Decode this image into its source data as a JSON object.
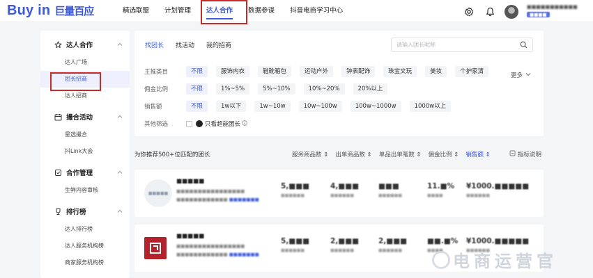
{
  "brand": {
    "en": "Buy in",
    "cn": "巨量百应"
  },
  "topnav": [
    {
      "label": "精选联盟",
      "active": false
    },
    {
      "label": "计划管理",
      "active": false
    },
    {
      "label": "达人合作",
      "active": true
    },
    {
      "label": "数据参谋",
      "active": false
    },
    {
      "label": "抖音电商学习中心",
      "active": false
    }
  ],
  "user": {
    "name": "■■■■■■■■■■■",
    "sub": "■■■■"
  },
  "sidebar": {
    "groups": [
      {
        "label": "达人合作",
        "icon": "star-icon",
        "items": [
          "达人广场",
          "团长招商",
          "达人招商"
        ]
      },
      {
        "label": "撮合活动",
        "icon": "calendar-icon",
        "items": [
          "星选撮合",
          "抖Link大会"
        ]
      },
      {
        "label": "合作管理",
        "icon": "handshake-icon",
        "items": [
          "生鲜内容审核"
        ]
      },
      {
        "label": "排行榜",
        "icon": "trophy-icon",
        "items": [
          "达人排行榜",
          "达人服务机构榜",
          "商家服务机构榜"
        ]
      }
    ],
    "active_item": "团长招商"
  },
  "tabs": [
    {
      "label": "找团长",
      "active": true
    },
    {
      "label": "找活动",
      "active": false
    },
    {
      "label": "我的招商",
      "active": false
    }
  ],
  "search": {
    "placeholder": "请输入团长昵称"
  },
  "filters": {
    "category": {
      "label": "主推类目",
      "options": [
        "不限",
        "服饰内衣",
        "鞋靴箱包",
        "运动户外",
        "钟表配饰",
        "珠宝文玩",
        "美妆",
        "个护家清"
      ],
      "more": "更多"
    },
    "commission": {
      "label": "佣金比例",
      "options": [
        "不限",
        "1%~5%",
        "5%~10%",
        "10%~20%",
        "20%以上"
      ]
    },
    "sales": {
      "label": "销售额",
      "options": [
        "不限",
        "1w以下",
        "1w~10w",
        "10w~100w",
        "100w~1000w",
        "1000w以上"
      ]
    },
    "other": {
      "label": "其他筛选",
      "checkbox_label": "只看超能团长"
    }
  },
  "list": {
    "title": "为你推荐500+位匹配的团长",
    "sorts": [
      {
        "label": "服务商品数",
        "active": false
      },
      {
        "label": "出单商品数",
        "active": false
      },
      {
        "label": "单品出单笔数",
        "active": false
      },
      {
        "label": "佣金比例",
        "active": false
      },
      {
        "label": "销售额",
        "active": true
      }
    ],
    "help": "指标说明"
  },
  "cards": [
    {
      "name": "■■■■■",
      "logo_text": "■■■■■",
      "desc": "■■■■■■■■■■■■■■■■",
      "links": "■■■■■■■■■■■■",
      "link_text": "■■■■■■■",
      "stats": [
        {
          "value": "5,■■■",
          "label": "■■■■■■"
        },
        {
          "value": "4,■■■",
          "label": "■■■■■■"
        },
        {
          "value": "■■■",
          "label": "■■■■■■"
        },
        {
          "value": "11.■%",
          "label": "■■■■"
        },
        {
          "value": "¥1000.■■■■■",
          "label": "■■■■■■"
        }
      ]
    },
    {
      "name": "■■■■■",
      "logo_text": "■■■■",
      "desc": "■■■■■■■■■■■■■■■■",
      "links": "■■■■■■■■■■■■",
      "link_text": "■■■■■■■",
      "stats": [
        {
          "value": "5,■■■",
          "label": "■■■■■■"
        },
        {
          "value": "2,■■■",
          "label": "■■■■■■"
        },
        {
          "value": "2,■■■",
          "label": "■■■■■■"
        },
        {
          "value": "■■.■%",
          "label": "■■■■"
        },
        {
          "value": "¥1000.■■■■■",
          "label": "■■■■■■"
        }
      ]
    }
  ],
  "watermark": "电商运营官",
  "colors": {
    "accent": "#3d5bd9",
    "highlight_box": "#c82a2a"
  }
}
